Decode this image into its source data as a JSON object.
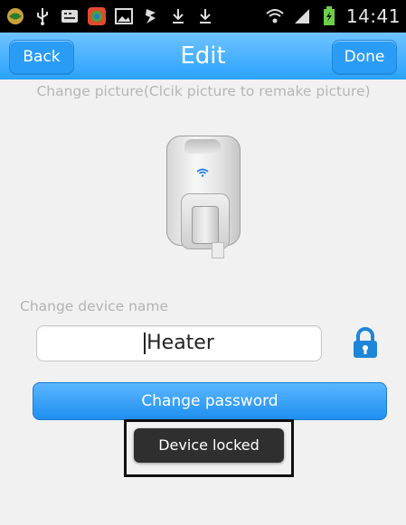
{
  "status_bar": {
    "icons": [
      "app-icon",
      "usb-icon",
      "keyboard-icon",
      "color-app-icon",
      "image-icon",
      "flash-icon",
      "download-icon",
      "download-icon",
      "wifi-icon",
      "signal-icon",
      "battery-icon"
    ],
    "time": "14:41"
  },
  "header": {
    "back_label": "Back",
    "title": "Edit",
    "done_label": "Done"
  },
  "picture_instruction": "Change picture(Clcik picture to remake picture)",
  "device_name_label": "Change device name",
  "device_name_value": "Heater",
  "change_password_label": "Change password",
  "toast_text": "Device locked",
  "colors": {
    "header_blue": "#2aa2ff",
    "lock_blue": "#1e86d9",
    "toast_bg": "#2f2f2f"
  }
}
